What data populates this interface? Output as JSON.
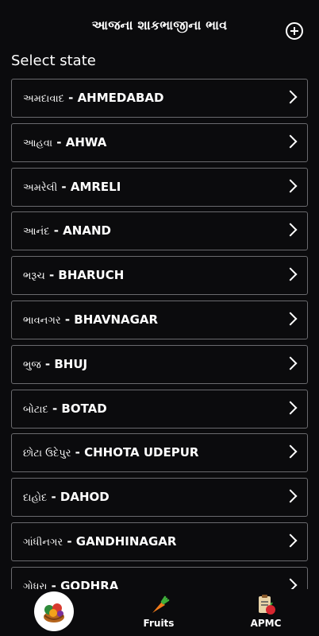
{
  "header": {
    "title": "આજના શાકભાજીના ભાવ",
    "add_icon": "plus-circle-icon"
  },
  "section_label": "Select state",
  "districts": [
    {
      "gu": "અમદાવાદ",
      "en": "AHMEDABAD"
    },
    {
      "gu": "આહવા",
      "en": "AHWA"
    },
    {
      "gu": "અમરેલી",
      "en": "AMRELI"
    },
    {
      "gu": "આનંદ",
      "en": "ANAND"
    },
    {
      "gu": "ભરૂચ",
      "en": "BHARUCH"
    },
    {
      "gu": "ભાવનગર",
      "en": "BHAVNAGAR"
    },
    {
      "gu": "ભુજ",
      "en": "BHUJ"
    },
    {
      "gu": "બોટાદ",
      "en": "BOTAD"
    },
    {
      "gu": "છોટા ઉદેપુર",
      "en": "CHHOTA UDEPUR"
    },
    {
      "gu": "દાહોદ",
      "en": "DAHOD"
    },
    {
      "gu": "ગાંધીનગર",
      "en": "GANDHINAGAR"
    },
    {
      "gu": "ગોધરા",
      "en": "GODHRA"
    }
  ],
  "separator": " - ",
  "bottom_nav": {
    "home_icon": "vegetable-basket-icon",
    "fruits_label": "Fruits",
    "fruits_icon": "carrot-icon",
    "apmc_label": "APMC",
    "apmc_icon": "clipboard-fruit-icon"
  }
}
